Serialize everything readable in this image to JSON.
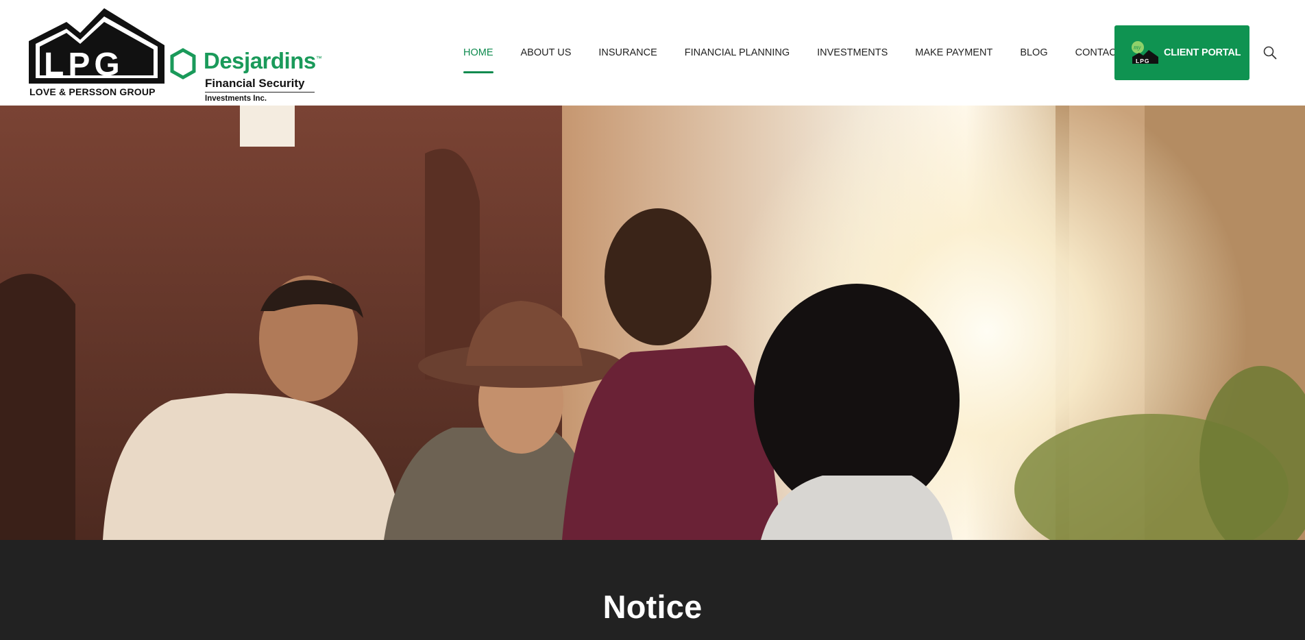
{
  "brand": {
    "lpg_letters": "LPG",
    "lpg_tagline": "LOVE & PERSSON GROUP",
    "partner_name": "Desjardins",
    "partner_tm": "™",
    "partner_line1": "Financial Security",
    "partner_line2": "Investments Inc."
  },
  "nav": {
    "items": [
      {
        "label": "HOME",
        "active": true
      },
      {
        "label": "ABOUT US",
        "active": false
      },
      {
        "label": "INSURANCE",
        "active": false
      },
      {
        "label": "FINANCIAL PLANNING",
        "active": false
      },
      {
        "label": "INVESTMENTS",
        "active": false
      },
      {
        "label": "MAKE PAYMENT",
        "active": false
      },
      {
        "label": "BLOG",
        "active": false
      },
      {
        "label": "CONTACT",
        "active": false
      }
    ],
    "portal_label": "CLIENT PORTAL",
    "portal_icon_text": "my",
    "search_icon": "search-icon"
  },
  "hero": {
    "image": "group of four smiling friends outdoors at sunset"
  },
  "notice": {
    "title": "Notice"
  },
  "colors": {
    "accent": "#0f9351",
    "active_nav": "#0e8a4e",
    "dark_band": "#222222"
  }
}
